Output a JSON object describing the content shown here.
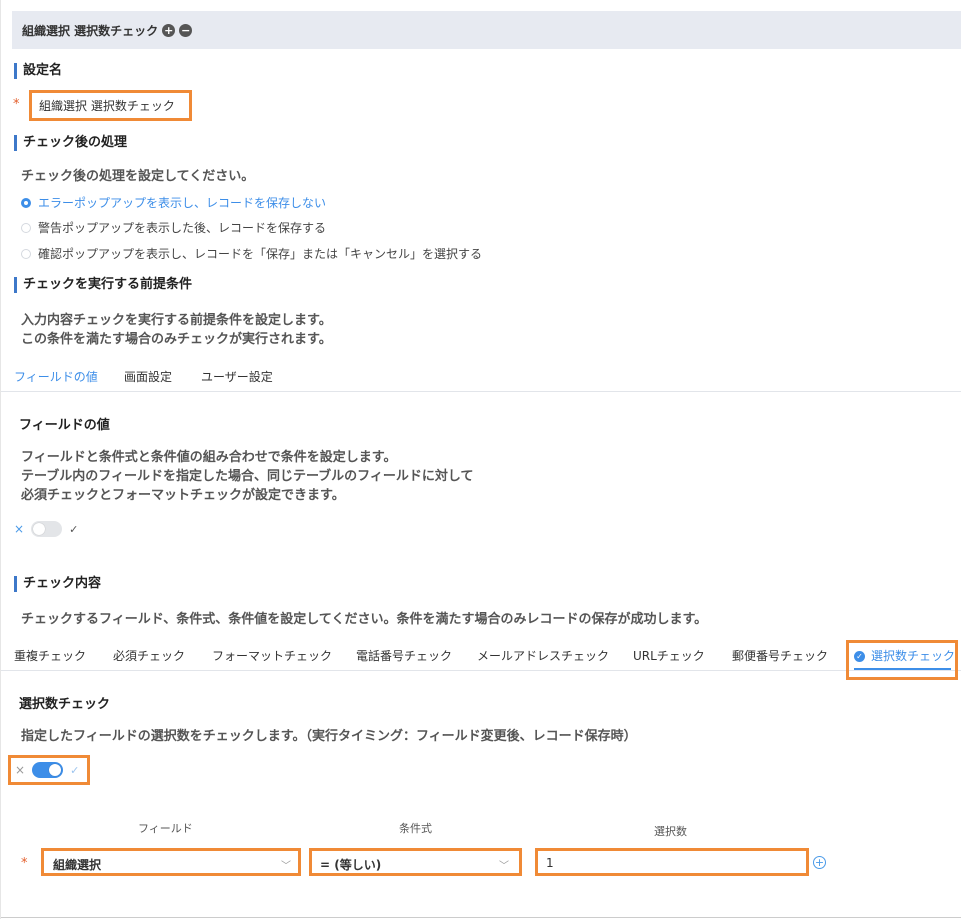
{
  "header": {
    "title": "組織選択 選択数チェック",
    "add_label": "+",
    "remove_label": "−"
  },
  "setting_name": {
    "title": "設定名",
    "required_mark": "*",
    "value": "組織選択 選択数チェック"
  },
  "after_check": {
    "title": "チェック後の処理",
    "description": "チェック後の処理を設定してください。",
    "options": [
      {
        "label": "エラーポップアップを表示し、レコードを保存しない",
        "selected": true
      },
      {
        "label": "警告ポップアップを表示した後、レコードを保存する",
        "selected": false
      },
      {
        "label": "確認ポップアップを表示し、レコードを「保存」または「キャンセル」を選択する",
        "selected": false
      }
    ]
  },
  "precondition": {
    "title": "チェックを実行する前提条件",
    "description_line1": "入力内容チェックを実行する前提条件を設定します。",
    "description_line2": "この条件を満たす場合のみチェックが実行されます。",
    "tabs": [
      "フィールドの値",
      "画面設定",
      "ユーザー設定"
    ],
    "active_tab": 0,
    "field_value": {
      "title": "フィールドの値",
      "line1": "フィールドと条件式と条件値の組み合わせで条件を設定します。",
      "line2": "テーブル内のフィールドを指定した場合、同じテーブルのフィールドに対して",
      "line3": "必須チェックとフォーマットチェックが設定できます。",
      "toggle_off_symbol": "×",
      "toggle_on_symbol": "✓",
      "enabled": false
    }
  },
  "check_content": {
    "title": "チェック内容",
    "description": "チェックするフィールド、条件式、条件値を設定してください。条件を満たす場合のみレコードの保存が成功します。",
    "tabs": [
      "重複チェック",
      "必須チェック",
      "フォーマットチェック",
      "電話番号チェック",
      "メールアドレスチェック",
      "URLチェック",
      "郵便番号チェック",
      "選択数チェック"
    ],
    "active_tab": 7,
    "selection_count": {
      "title": "選択数チェック",
      "description": "指定したフィールドの選択数をチェックします。（実行タイミング：フィールド変更後、レコード保存時）",
      "toggle_off_symbol": "×",
      "toggle_on_symbol": "✓",
      "enabled": true,
      "columns": {
        "field": "フィールド",
        "condition": "条件式",
        "count": "選択数"
      },
      "row": {
        "required_mark": "*",
        "field": "組織選択",
        "condition": "= (等しい)",
        "count": "1"
      }
    }
  },
  "colors": {
    "accent": "#3d8ee8",
    "highlight": "#f08a36",
    "required": "#e35e2b"
  }
}
